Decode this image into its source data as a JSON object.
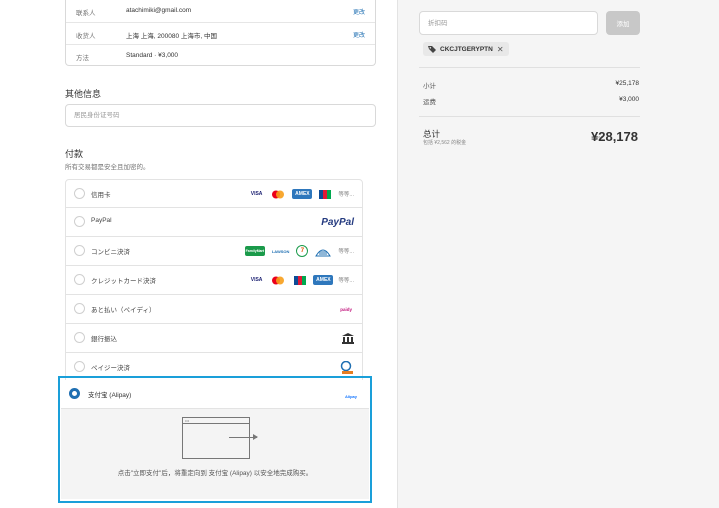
{
  "summary": [
    {
      "label": "联系人",
      "value": "atachimiki@gmail.com",
      "change": "更改"
    },
    {
      "label": "收货人",
      "value": "上海 上海, 200080 上海市, 中国",
      "change": "更改"
    },
    {
      "label": "方法",
      "value": "Standard · ¥3,000",
      "change": ""
    }
  ],
  "other_info": {
    "title": "其他信息",
    "placeholder": "居民身份证号码"
  },
  "payment": {
    "title": "付款",
    "subtitle": "所有交易都是安全且加密的。",
    "options": [
      {
        "label": "信用卡",
        "logos": [
          "VISA",
          "MC",
          "AMEX",
          "JCB"
        ],
        "more": "等等..."
      },
      {
        "label": "PayPal",
        "logos": [
          "PayPal"
        ],
        "more": ""
      },
      {
        "label": "コンビニ決済",
        "logos": [
          "FamilyMart",
          "LAWSON",
          "7",
          "Seico"
        ],
        "more": "等等..."
      },
      {
        "label": "クレジットカード決済",
        "logos": [
          "VISA",
          "MC",
          "JCB",
          "AMEX"
        ],
        "more": "等等..."
      },
      {
        "label": "あと払い（ペイディ）",
        "logos": [
          "paidy"
        ],
        "more": ""
      },
      {
        "label": "銀行振込",
        "logos": [
          "bank-icon"
        ],
        "more": ""
      },
      {
        "label": "ペイジー決済",
        "logos": [
          "Pay-easy"
        ],
        "more": ""
      }
    ],
    "selected": {
      "label": "支付宝 (Alipay)",
      "logo": "Alipay",
      "redirect_text": "点击\"立即支付\"后，将重定向到 支付宝 (Alipay) 以安全地完成购买。"
    }
  },
  "sidebar": {
    "discount_placeholder": "折扣码",
    "apply_label": "添加",
    "applied_code": "CKCJTGERYPTN",
    "subtotal_label": "小计",
    "subtotal_value": "¥25,178",
    "shipping_label": "运费",
    "shipping_value": "¥3,000",
    "total_label": "总计",
    "tax_note": "包括 ¥2,562 的税金",
    "currency": "JPY",
    "total_value": "¥28,178"
  },
  "colors": {
    "accent": "#1f6fb2",
    "highlight_border": "#1a9fd9"
  }
}
